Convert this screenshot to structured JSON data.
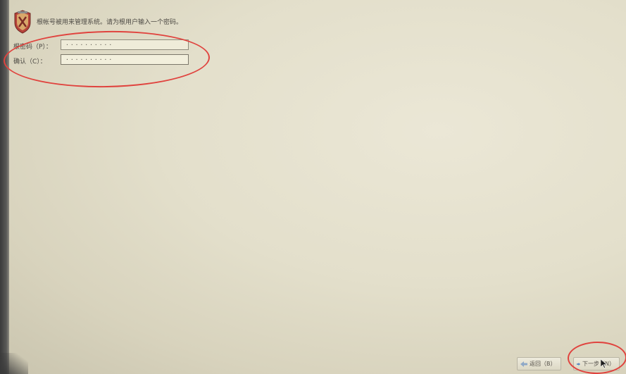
{
  "header": {
    "text": "根帐号被用来管理系统。请为根用户输入一个密码。",
    "logo_icon": "shield-logo-icon"
  },
  "form": {
    "password_label": "根密码（P）：",
    "password_value": "··········",
    "confirm_label": "确认（C）：",
    "confirm_value": "··········"
  },
  "nav": {
    "back_label": "返回（B）",
    "next_label": "下一步（N）",
    "back_icon": "arrow-left-icon",
    "next_icon": "arrow-right-icon"
  },
  "colors": {
    "background": "#e3dfcb",
    "annotation": "#e0433e",
    "arrow": "#4a7fc1"
  }
}
